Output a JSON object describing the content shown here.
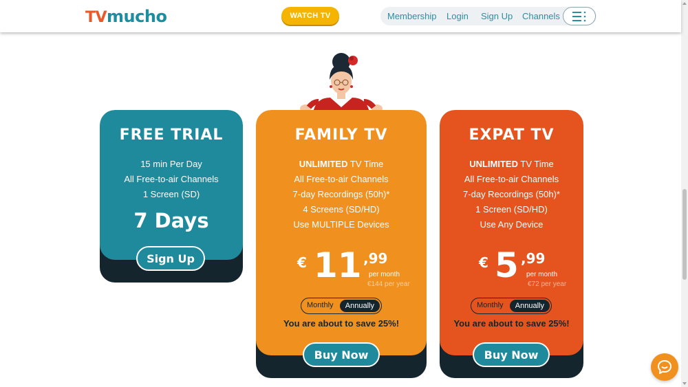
{
  "header": {
    "logo_tv": "TV",
    "logo_mucho": "mucho",
    "watch_label": "WATCH TV",
    "nav": [
      "Membership",
      "Login",
      "Sign Up",
      "Channels"
    ]
  },
  "plans": {
    "free": {
      "title": "FREE TRIAL",
      "features": [
        "15 min Per Day",
        "All Free-to-air Channels",
        "1 Screen (SD)"
      ],
      "duration": "7 Days",
      "button": "Sign Up"
    },
    "family": {
      "title": "FAMILY TV",
      "feature_bold": "UNLIMITED",
      "feature_rest": " TV Time",
      "features": [
        "All Free-to-air Channels",
        "7-day Recordings (50h)*",
        "4 Screens (SD/HD)",
        "Use MULTIPLE Devices"
      ],
      "currency": "€",
      "price_int": "11",
      "price_dec": ",99",
      "per": "per month",
      "yearly": "€144 per year",
      "toggle_monthly": "Monthly",
      "toggle_annually": "Annually",
      "save": "You are about to save 25%!",
      "button": "Buy Now"
    },
    "expat": {
      "title": "EXPAT TV",
      "feature_bold": "UNLIMITED",
      "feature_rest": " TV Time",
      "features": [
        "All Free-to-air Channels",
        "7-day Recordings (50h)*",
        "1 Screen (SD/HD)",
        "Use Any Device"
      ],
      "currency": "€",
      "price_int": "5",
      "price_dec": ",99",
      "per": "per month",
      "yearly": "€72 per year",
      "toggle_monthly": "Monthly",
      "toggle_annually": "Annually",
      "save": "You are about to save 25%!",
      "button": "Buy Now"
    }
  },
  "colors": {
    "teal": "#1f8a9c",
    "orange": "#f0911f",
    "red_orange": "#e5541f",
    "navy": "#14252e",
    "yellow": "#f4b400"
  },
  "icons": {
    "menu": "menu-dots-icon",
    "chat": "chat-bubble-icon"
  }
}
